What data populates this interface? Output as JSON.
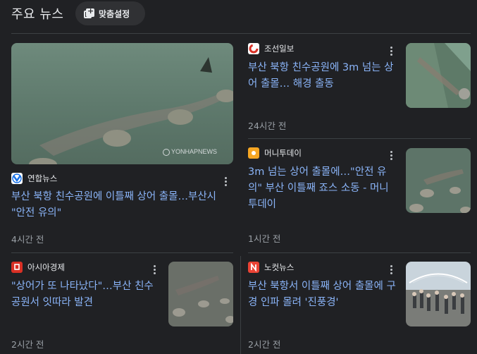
{
  "header": {
    "title": "주요 뉴스",
    "customize_label": "맞춤설정"
  },
  "articles": [
    {
      "source": "연합뉴스",
      "headline": "부산 북항 친수공원에 이틀째 상어 출몰…부산시 \"안전 유의\"",
      "time": "4시간 전",
      "logo_color": "#1a73e8",
      "watermark": "YONHAPNEWS"
    },
    {
      "source": "조선일보",
      "headline": "부산 북항 친수공원에 3m 넘는 상어 출몰… 해경 출동",
      "time": "24시간 전",
      "logo_color": "#ffffff"
    },
    {
      "source": "머니투데이",
      "headline": "3m 넘는 상어 출몰에…\"안전 유의\" 부산 이틀째 죠스 소동 - 머니투데이",
      "time": "1시간 전",
      "logo_color": "#f5a623"
    },
    {
      "source": "아시아경제",
      "headline": "\"상어가 또 나타났다\"…부산 친수공원서 잇따라 발견",
      "time": "2시간 전",
      "logo_color": "#d93025"
    },
    {
      "source": "노컷뉴스",
      "headline": "부산 북항서 이틀째 상어 출몰에 구경 인파 몰려 '진풍경'",
      "time": "2시간 전",
      "logo_color": "#ea4335"
    }
  ],
  "colors": {
    "background": "#202124",
    "link": "#8ab4f8",
    "muted": "#9aa0a6"
  }
}
